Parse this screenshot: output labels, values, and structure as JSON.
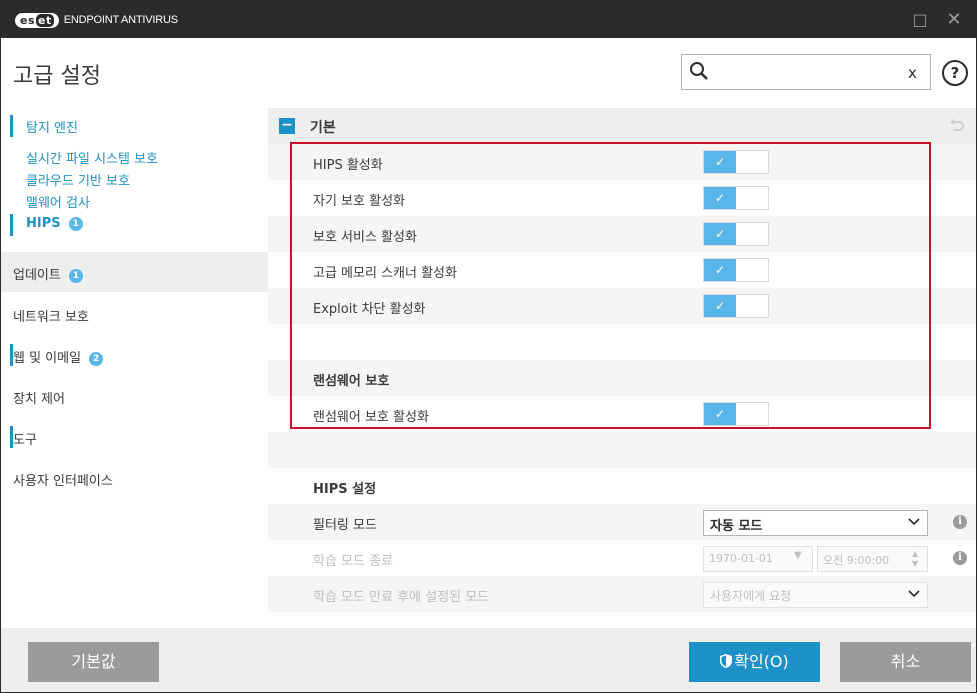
{
  "titlebar": {
    "logo_text": "eset",
    "product_name": "ENDPOINT ANTIVIRUS",
    "maximize_symbol": "□",
    "close_symbol": "✕"
  },
  "header": {
    "title": "고급 설정",
    "search": {
      "value": "",
      "placeholder": "",
      "clear_symbol": "x"
    },
    "help_symbol": "?"
  },
  "sidebar": {
    "items": [
      {
        "label": "탐지 엔진"
      },
      {
        "label": "실시간 파일 시스템 보호"
      },
      {
        "label": "클라우드 기반 보호"
      },
      {
        "label": "맬웨어 검사"
      },
      {
        "label": "HIPS",
        "badge": "1"
      },
      {
        "label": "업데이트",
        "badge": "1"
      },
      {
        "label": "네트워크 보호"
      },
      {
        "label": "웹 및 이메일",
        "badge": "2"
      },
      {
        "label": "장치 제어"
      },
      {
        "label": "도구"
      },
      {
        "label": "사용자 인터페이스"
      }
    ]
  },
  "section": {
    "collapse_symbol": "−",
    "title": "기본"
  },
  "settings": {
    "hips_enable": {
      "label": "HIPS 활성화",
      "enabled": true
    },
    "self_protect": {
      "label": "자기 보호 활성화",
      "enabled": true
    },
    "protected_service": {
      "label": "보호 서비스 활성화",
      "enabled": true
    },
    "memory_scanner": {
      "label": "고급 메모리 스캐너 활성화",
      "enabled": true
    },
    "exploit_blocker": {
      "label": "Exploit 차단 활성화",
      "enabled": true
    },
    "ransomware_group": "랜섬웨어 보호",
    "ransomware_enable": {
      "label": "랜섬웨어 보호 활성화",
      "enabled": true
    },
    "hips_settings_group": "HIPS 설정",
    "filter_mode": {
      "label": "필터링 모드",
      "value": "자동 모드"
    },
    "learning_end": {
      "label": "학습 모드 종료",
      "date": "1970-01-01",
      "time": "오전   9:00:00"
    },
    "after_learning": {
      "label": "학습 모드 만료 후에 설정된 모드",
      "value": "사용자에게 요청"
    },
    "check_symbol": "✓",
    "info_symbol": "i"
  },
  "footer": {
    "default_label": "기본값",
    "ok_label": "확인(O)",
    "cancel_label": "취소"
  },
  "colors": {
    "accent": "#1e92c8",
    "toggle_on": "#5ab6e8",
    "highlight_border": "#c8102e",
    "titlebar": "#2b2b2b"
  }
}
